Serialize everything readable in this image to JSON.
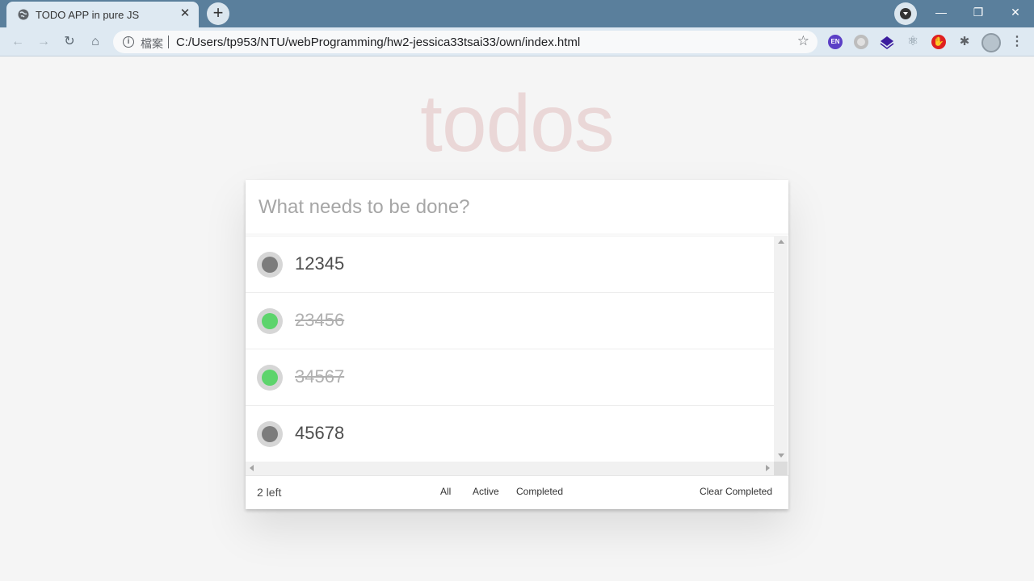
{
  "browser": {
    "tab_title": "TODO APP in pure JS",
    "tab_close": "✕",
    "new_tab": "+",
    "omnibox_label": "檔案",
    "url": "C:/Users/tp953/NTU/webProgramming/hw2-jessica33tsai33/own/index.html",
    "extension_en": "EN",
    "win_minimize": "—",
    "win_restore": "❐",
    "win_close": "✕"
  },
  "app": {
    "heading": "todos",
    "input_placeholder": "What needs to be done?",
    "todos": [
      {
        "text": "12345",
        "completed": false
      },
      {
        "text": "23456",
        "completed": true
      },
      {
        "text": "34567",
        "completed": true
      },
      {
        "text": "45678",
        "completed": false
      }
    ],
    "footer": {
      "count": "2 left",
      "filters": [
        "All",
        "Active",
        "Completed"
      ],
      "clear_label": "Clear Completed"
    }
  },
  "colors": {
    "incomplete_dot": "#7c7c7c",
    "complete_dot": "#5dd46c",
    "heading": "rgba(175,47,47,0.15)"
  }
}
